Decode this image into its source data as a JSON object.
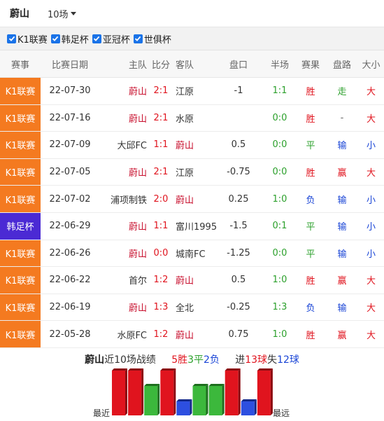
{
  "header": {
    "team": "蔚山",
    "count_label": "10场"
  },
  "filters": [
    {
      "label": "K1联赛",
      "checked": true
    },
    {
      "label": "韩足杯",
      "checked": true
    },
    {
      "label": "亚冠杯",
      "checked": true
    },
    {
      "label": "世俱杯",
      "checked": true
    }
  ],
  "columns": [
    "赛事",
    "比赛日期",
    "主队",
    "比分",
    "客队",
    "盘口",
    "半场",
    "赛果",
    "盘路",
    "大小"
  ],
  "rows": [
    {
      "comp": "K1联赛",
      "date": "22-07-30",
      "home": "蔚山",
      "score": "2:1",
      "away": "江原",
      "handicap": "-1",
      "half": "1:1",
      "result": "胜",
      "pan": "走",
      "ou": "大"
    },
    {
      "comp": "K1联赛",
      "date": "22-07-16",
      "home": "蔚山",
      "score": "2:1",
      "away": "水原",
      "handicap": "",
      "half": "0:0",
      "result": "胜",
      "pan": "-",
      "ou": "大"
    },
    {
      "comp": "K1联赛",
      "date": "22-07-09",
      "home": "大邱FC",
      "score": "1:1",
      "away": "蔚山",
      "handicap": "0.5",
      "half": "0:0",
      "result": "平",
      "pan": "输",
      "ou": "小"
    },
    {
      "comp": "K1联赛",
      "date": "22-07-05",
      "home": "蔚山",
      "score": "2:1",
      "away": "江原",
      "handicap": "-0.75",
      "half": "0:0",
      "result": "胜",
      "pan": "赢",
      "ou": "大"
    },
    {
      "comp": "K1联赛",
      "date": "22-07-02",
      "home": "浦项制铁",
      "score": "2:0",
      "away": "蔚山",
      "handicap": "0.25",
      "half": "1:0",
      "result": "负",
      "pan": "输",
      "ou": "小"
    },
    {
      "comp": "韩足杯",
      "date": "22-06-29",
      "home": "蔚山",
      "score": "1:1",
      "away": "富川1995",
      "handicap": "-1.5",
      "half": "0:1",
      "result": "平",
      "pan": "输",
      "ou": "小"
    },
    {
      "comp": "K1联赛",
      "date": "22-06-26",
      "home": "蔚山",
      "score": "0:0",
      "away": "城南FC",
      "handicap": "-1.25",
      "half": "0:0",
      "result": "平",
      "pan": "输",
      "ou": "小"
    },
    {
      "comp": "K1联赛",
      "date": "22-06-22",
      "home": "首尔",
      "score": "1:2",
      "away": "蔚山",
      "handicap": "0.5",
      "half": "1:0",
      "result": "胜",
      "pan": "赢",
      "ou": "大"
    },
    {
      "comp": "K1联赛",
      "date": "22-06-19",
      "home": "蔚山",
      "score": "1:3",
      "away": "全北",
      "handicap": "-0.25",
      "half": "1:3",
      "result": "负",
      "pan": "输",
      "ou": "大"
    },
    {
      "comp": "K1联赛",
      "date": "22-05-28",
      "home": "水原FC",
      "score": "1:2",
      "away": "蔚山",
      "handicap": "0.75",
      "half": "1:0",
      "result": "胜",
      "pan": "赢",
      "ou": "大"
    }
  ],
  "summary": {
    "team": "蔚山",
    "text_recent": "近10场战绩",
    "wins": "5胜",
    "draws": "3平",
    "losses": "2负",
    "goals_for_prefix": "进",
    "goals_for": "13球",
    "goals_against_prefix": "失",
    "goals_against": "12球"
  },
  "chart_labels": {
    "recent": "最近",
    "far": "最远"
  },
  "form_bars": [
    "胜",
    "胜",
    "平",
    "胜",
    "负",
    "平",
    "平",
    "胜",
    "负",
    "胜"
  ],
  "colors": {
    "k1": "#f47a20",
    "cup": "#4b2ad4",
    "win": "#e0141e",
    "draw": "#2ca02c",
    "loss": "#1a45d6",
    "highlight": "#c8102e"
  }
}
